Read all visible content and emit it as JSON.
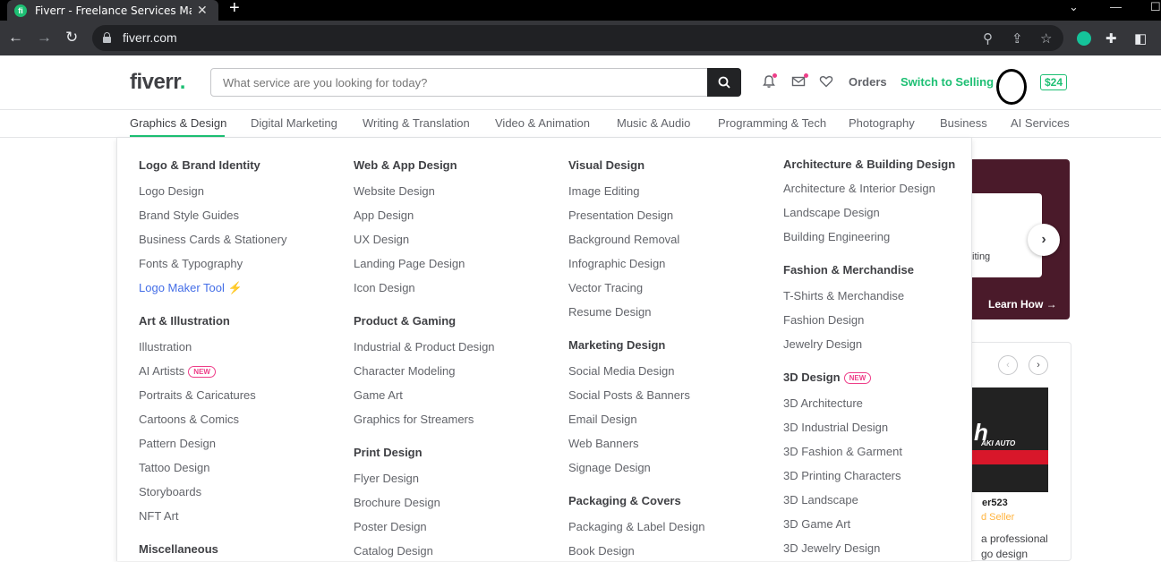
{
  "browser": {
    "tab_title": "Fiverr - Freelance Services Market",
    "favicon_letter": "fi",
    "url": "fiverr.com"
  },
  "header": {
    "logo_text": "fiverr",
    "logo_dot": ".",
    "search_placeholder": "What service are you looking for today?",
    "orders": "Orders",
    "switch": "Switch to Selling",
    "balance": "$24"
  },
  "categories": [
    "Graphics & Design",
    "Digital Marketing",
    "Writing & Translation",
    "Video & Animation",
    "Music & Audio",
    "Programming & Tech",
    "Photography",
    "Business",
    "AI Services"
  ],
  "menu": {
    "col1": {
      "g1_title": "Logo & Brand Identity",
      "g1": [
        "Logo Design",
        "Brand Style Guides",
        "Business Cards & Stationery",
        "Fonts & Typography",
        "Logo Maker Tool"
      ],
      "g2_title": "Art & Illustration",
      "g2": [
        "Illustration",
        "AI Artists",
        "Portraits & Caricatures",
        "Cartoons & Comics",
        "Pattern Design",
        "Tattoo Design",
        "Storyboards",
        "NFT Art"
      ],
      "g3_title": "Miscellaneous"
    },
    "col2": {
      "g1_title": "Web & App Design",
      "g1": [
        "Website Design",
        "App Design",
        "UX Design",
        "Landing Page Design",
        "Icon Design"
      ],
      "g2_title": "Product & Gaming",
      "g2": [
        "Industrial & Product Design",
        "Character Modeling",
        "Game Art",
        "Graphics for Streamers"
      ],
      "g3_title": "Print Design",
      "g3": [
        "Flyer Design",
        "Brochure Design",
        "Poster Design",
        "Catalog Design"
      ]
    },
    "col3": {
      "g1_title": "Visual Design",
      "g1": [
        "Image Editing",
        "Presentation Design",
        "Background Removal",
        "Infographic Design",
        "Vector Tracing",
        "Resume Design"
      ],
      "g2_title": "Marketing Design",
      "g2": [
        "Social Media Design",
        "Social Posts & Banners",
        "Email Design",
        "Web Banners",
        "Signage Design"
      ],
      "g3_title": "Packaging & Covers",
      "g3": [
        "Packaging & Label Design",
        "Book Design"
      ]
    },
    "col4": {
      "g1_title": "Architecture & Building Design",
      "g1": [
        "Architecture & Interior Design",
        "Landscape Design",
        "Building Engineering"
      ],
      "g2_title": "Fashion & Merchandise",
      "g2": [
        "T-Shirts & Merchandise",
        "Fashion Design",
        "Jewelry Design"
      ],
      "g3_title": "3D Design",
      "g3": [
        "3D Architecture",
        "3D Industrial Design",
        "3D Fashion & Garment",
        "3D Printing Characters",
        "3D Landscape",
        "3D Game Art",
        "3D Jewelry Design"
      ]
    },
    "new_badge": "NEW"
  },
  "side": {
    "promo_text": "iting",
    "learn_how": "Learn How",
    "gig_brand": "AKI AUTO",
    "gig_logo": "h",
    "seller_name": "er523",
    "seller_level": "d Seller",
    "desc1": "a professional",
    "desc2": "go design"
  },
  "colors": {
    "brand_green": "#1dbf73",
    "badge_pink": "#ee3e89",
    "link_blue": "#446ee7"
  }
}
